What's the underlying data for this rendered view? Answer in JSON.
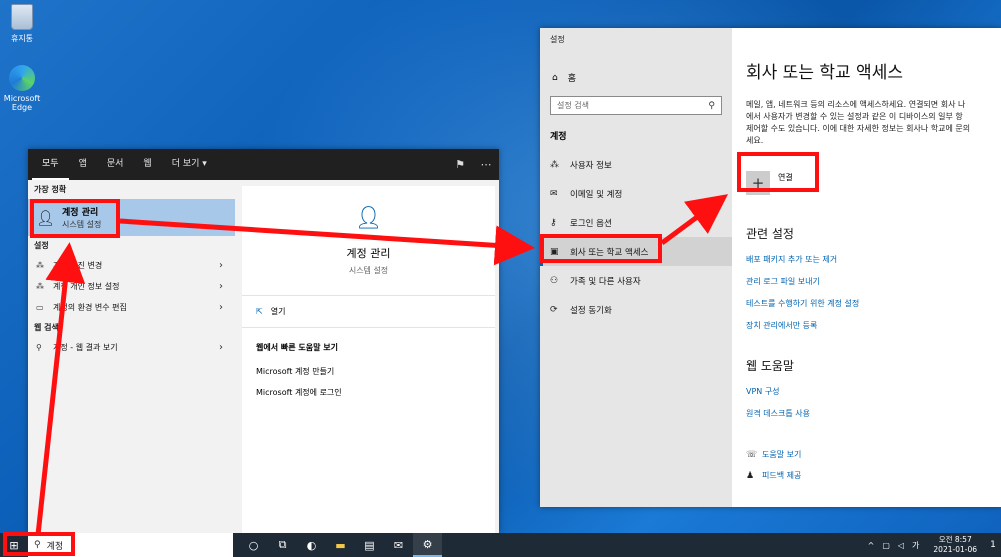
{
  "desktop": {
    "icons": [
      {
        "label": "휴지통",
        "icon": "recycle-bin-icon"
      },
      {
        "label": "Microsoft Edge",
        "icon": "edge-icon"
      }
    ]
  },
  "start_menu": {
    "tabs": [
      "모두",
      "앱",
      "문서",
      "웹",
      "더 보기 ▾"
    ],
    "best_match_label": "가장 정확",
    "best_match": {
      "title": "계정 관리",
      "subtitle": "시스템 설정",
      "icon": "account-icon"
    },
    "settings_label": "설정",
    "settings_results": [
      {
        "label": "계정 사진 변경",
        "icon": "account-icon"
      },
      {
        "label": "계정 개인 정보 설정",
        "icon": "account-icon"
      },
      {
        "label": "계정의 환경 변수 편집",
        "icon": "monitor-icon"
      }
    ],
    "web_label": "웹 검색",
    "web_result": "계정 - 웹 결과 보기",
    "preview": {
      "title": "계정 관리",
      "subtitle": "시스템 설정",
      "open_label": "열기",
      "web_help_heading": "웹에서 빠른 도움말 보기",
      "web_help_items": [
        "Microsoft 계정 만들기",
        "Microsoft 계정에 로그인"
      ]
    }
  },
  "settings_window": {
    "window_title": "설정",
    "home": "홈",
    "search_placeholder": "설정 검색",
    "category": "계정",
    "nav": [
      {
        "label": "사용자 정보",
        "icon": "person-card-icon",
        "active": false
      },
      {
        "label": "이메일 및 계정",
        "icon": "mail-icon",
        "active": false
      },
      {
        "label": "로그인 옵션",
        "icon": "key-icon",
        "active": false
      },
      {
        "label": "회사 또는 학교 액세스",
        "icon": "briefcase-icon",
        "active": true
      },
      {
        "label": "가족 및 다른 사용자",
        "icon": "person-add-icon",
        "active": false
      },
      {
        "label": "설정 동기화",
        "icon": "sync-icon",
        "active": false
      }
    ],
    "page_title": "회사 또는 학교 액세스",
    "description": "메일, 앱, 네트워크 등의 리소스에 액세스하세요. 연결되면 회사 나\n에서 사용자가 변경할 수 있는 설정과 같은 이 디바이스의 일부 항\n제어할 수도 있습니다. 이에 대한 자세한 정보는 회사나 학교에 문의\n세요.",
    "connect_label": "연결",
    "related_heading": "관련 설정",
    "related_links": [
      "배포 패키지 추가 또는 제거",
      "관리 로그 파일 보내기",
      "테스트를 수행하기 위한 계정 설정",
      "장치 관리에서만 등록"
    ],
    "web_help_heading": "웹 도움말",
    "web_help_links": [
      "VPN 구성",
      "원격 데스크톱 사용"
    ],
    "bottom_links": [
      {
        "label": "도움말 보기",
        "icon": "help-icon"
      },
      {
        "label": "피드백 제공",
        "icon": "feedback-icon"
      }
    ]
  },
  "taskbar": {
    "search_text": "계정",
    "pinned": [
      "cortana-icon",
      "task-view-icon",
      "edge-icon",
      "file-explorer-icon",
      "store-icon",
      "mail-icon",
      "settings-icon"
    ],
    "ime": "가",
    "clock_time": "오전 8:57",
    "clock_date": "2021-01-06",
    "notification_count": "1"
  },
  "annotation_color": "#ff1010"
}
